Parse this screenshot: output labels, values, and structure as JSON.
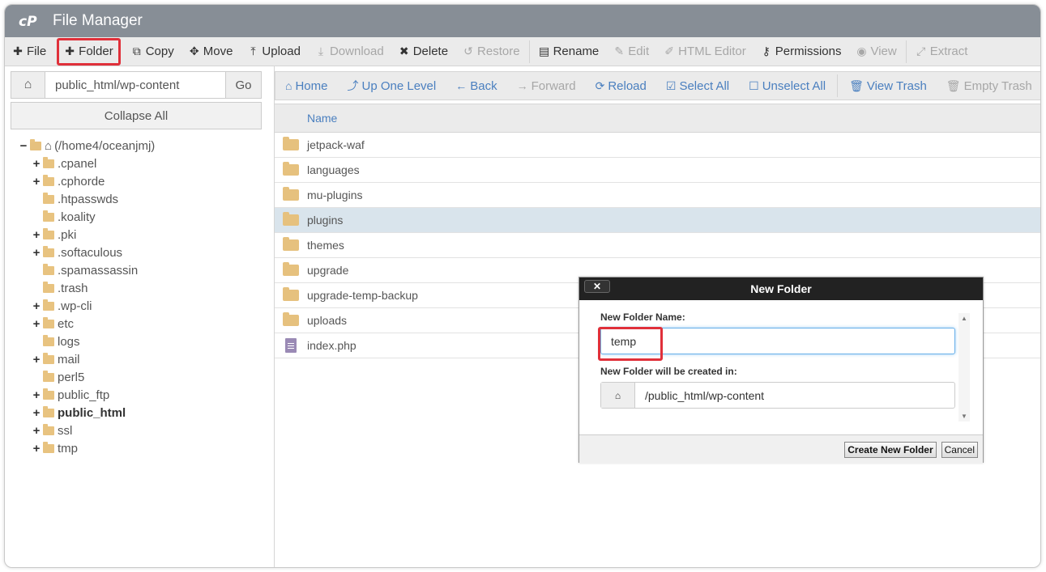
{
  "app": {
    "title": "File Manager"
  },
  "toolbar": [
    {
      "label": "File",
      "icon": "plus-icon",
      "glyph": "✚",
      "disabled": false,
      "highlight": false
    },
    {
      "label": "Folder",
      "icon": "plus-icon",
      "glyph": "✚",
      "disabled": false,
      "highlight": true
    },
    {
      "label": "Copy",
      "icon": "copy-icon",
      "glyph": "⧉",
      "disabled": false,
      "highlight": false
    },
    {
      "label": "Move",
      "icon": "move-icon",
      "glyph": "✥",
      "disabled": false,
      "highlight": false
    },
    {
      "label": "Upload",
      "icon": "upload-icon",
      "glyph": "⤒",
      "disabled": false,
      "highlight": false
    },
    {
      "label": "Download",
      "icon": "download-icon",
      "glyph": "⤓",
      "disabled": true,
      "highlight": false
    },
    {
      "label": "Delete",
      "icon": "delete-icon",
      "glyph": "✖",
      "disabled": false,
      "highlight": false
    },
    {
      "label": "Restore",
      "icon": "restore-icon",
      "glyph": "↺",
      "disabled": true,
      "highlight": false
    },
    {
      "label": "Rename",
      "icon": "rename-icon",
      "glyph": "▤",
      "disabled": false,
      "highlight": false
    },
    {
      "label": "Edit",
      "icon": "pencil-icon",
      "glyph": "✎",
      "disabled": true,
      "highlight": false
    },
    {
      "label": "HTML Editor",
      "icon": "html-editor-icon",
      "glyph": "✐",
      "disabled": true,
      "highlight": false
    },
    {
      "label": "Permissions",
      "icon": "key-icon",
      "glyph": "⚷",
      "disabled": false,
      "highlight": false
    },
    {
      "label": "View",
      "icon": "eye-icon",
      "glyph": "◉",
      "disabled": true,
      "highlight": false
    },
    {
      "label": "Extract",
      "icon": "extract-icon",
      "glyph": "⤢",
      "disabled": true,
      "highlight": false
    }
  ],
  "path": {
    "value": "public_html/wp-content",
    "go_label": "Go"
  },
  "sidebar": {
    "collapse_label": "Collapse All",
    "root": "(/home4/oceanjmj)",
    "items": [
      {
        "label": ".cpanel",
        "expand": "+",
        "bold": false
      },
      {
        "label": ".cphorde",
        "expand": "+",
        "bold": false
      },
      {
        "label": ".htpasswds",
        "expand": "",
        "bold": false
      },
      {
        "label": ".koality",
        "expand": "",
        "bold": false
      },
      {
        "label": ".pki",
        "expand": "+",
        "bold": false
      },
      {
        "label": ".softaculous",
        "expand": "+",
        "bold": false
      },
      {
        "label": ".spamassassin",
        "expand": "",
        "bold": false
      },
      {
        "label": ".trash",
        "expand": "",
        "bold": false
      },
      {
        "label": ".wp-cli",
        "expand": "+",
        "bold": false
      },
      {
        "label": "etc",
        "expand": "+",
        "bold": false
      },
      {
        "label": "logs",
        "expand": "",
        "bold": false
      },
      {
        "label": "mail",
        "expand": "+",
        "bold": false
      },
      {
        "label": "perl5",
        "expand": "",
        "bold": false
      },
      {
        "label": "public_ftp",
        "expand": "+",
        "bold": false
      },
      {
        "label": "public_html",
        "expand": "+",
        "bold": true
      },
      {
        "label": "ssl",
        "expand": "+",
        "bold": false
      },
      {
        "label": "tmp",
        "expand": "+",
        "bold": false
      }
    ]
  },
  "navbar": [
    {
      "label": "Home",
      "glyph": "⌂",
      "icon": "home-icon",
      "disabled": false
    },
    {
      "label": "Up One Level",
      "glyph": "⤴",
      "icon": "up-level-icon",
      "disabled": false
    },
    {
      "label": "Back",
      "glyph": "←",
      "icon": "back-arrow-icon",
      "disabled": false
    },
    {
      "label": "Forward",
      "glyph": "→",
      "icon": "forward-arrow-icon",
      "disabled": true
    },
    {
      "label": "Reload",
      "glyph": "⟳",
      "icon": "reload-icon",
      "disabled": false
    },
    {
      "label": "Select All",
      "glyph": "☑",
      "icon": "checkbox-checked-icon",
      "disabled": false
    },
    {
      "label": "Unselect All",
      "glyph": "☐",
      "icon": "checkbox-empty-icon",
      "disabled": false
    },
    {
      "label": "View Trash",
      "glyph": "🗑",
      "icon": "trash-icon",
      "disabled": false
    },
    {
      "label": "Empty Trash",
      "glyph": "🗑",
      "icon": "trash-icon",
      "disabled": true
    }
  ],
  "list": {
    "header_name": "Name",
    "rows": [
      {
        "name": "jetpack-waf",
        "type": "folder",
        "selected": false
      },
      {
        "name": "languages",
        "type": "folder",
        "selected": false
      },
      {
        "name": "mu-plugins",
        "type": "folder",
        "selected": false
      },
      {
        "name": "plugins",
        "type": "folder",
        "selected": true
      },
      {
        "name": "themes",
        "type": "folder",
        "selected": false
      },
      {
        "name": "upgrade",
        "type": "folder",
        "selected": false
      },
      {
        "name": "upgrade-temp-backup",
        "type": "folder",
        "selected": false
      },
      {
        "name": "uploads",
        "type": "folder",
        "selected": false
      },
      {
        "name": "index.php",
        "type": "file",
        "selected": false
      }
    ]
  },
  "dialog": {
    "title": "New Folder",
    "close_glyph": "✕",
    "name_label": "New Folder Name:",
    "name_value": "temp",
    "location_label": "New Folder will be created in:",
    "location_value": "/public_html/wp-content",
    "create_label": "Create New Folder",
    "cancel_label": "Cancel"
  },
  "colors": {
    "titlebar": "#878e96",
    "link": "#4a7fbf",
    "highlight": "#e0303a",
    "folder": "#e6c17e",
    "selected_row": "#d9e4ec"
  }
}
